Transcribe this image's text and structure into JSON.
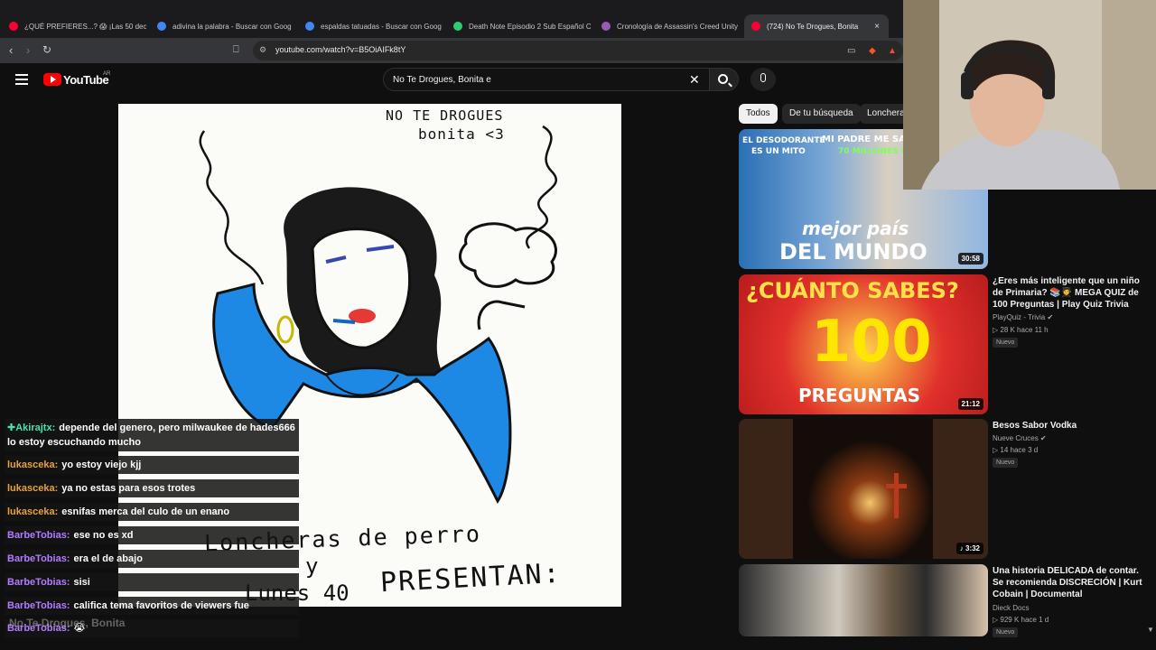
{
  "browser": {
    "tabs": [
      {
        "label": "¿QUÉ PREFIERES...? 😱 ¡Las 50 decisi",
        "color": "#ff0033"
      },
      {
        "label": "adivina la palabra - Buscar con Goog",
        "color": "#4285f4"
      },
      {
        "label": "espaldas tatuadas - Buscar con Goog",
        "color": "#4285f4"
      },
      {
        "label": "Death Note Episodio 2 Sub Español C",
        "color": "#2ecc71"
      },
      {
        "label": "Cronología de Assassin's Creed Unity",
        "color": "#9b59b6"
      },
      {
        "label": "(724) No Te Drogues, Bonita",
        "color": "#ff0033"
      }
    ],
    "tab_close": "×",
    "url": "youtube.com/watch?v=B5OiAIFk8tY"
  },
  "youtube": {
    "logo": "YouTube",
    "region": "AR",
    "search_value": "No Te Drogues, Bonita e",
    "clear": "✕"
  },
  "video": {
    "drawing_text": {
      "line1": "NO TE DROGUES",
      "line2": "bonita <3",
      "line3": "Loncheras de perro",
      "line4": "y",
      "line5": "Lunes 40",
      "line6": "PRESENTAN:"
    },
    "watermark": "No Te Drogues, Bonita"
  },
  "chat": [
    {
      "user": "✚Akirajtx:",
      "text": "depende del genero, pero milwaukee de hades666 lo estoy escuchando mucho",
      "color": "green"
    },
    {
      "user": "lukasceka:",
      "text": "yo estoy viejo kjj",
      "color": "orange"
    },
    {
      "user": "lukasceka:",
      "text": "ya no estas para esos trotes",
      "color": "orange"
    },
    {
      "user": "lukasceka:",
      "text": "esnifas merca del culo de un enano",
      "color": "orange"
    },
    {
      "user": "BarbeTobias:",
      "text": "ese no es xd",
      "color": "purple"
    },
    {
      "user": "BarbeTobias:",
      "text": "era el de abajo",
      "color": "purple"
    },
    {
      "user": "BarbeTobias:",
      "text": "sisi",
      "color": "purple"
    },
    {
      "user": "BarbeTobias:",
      "text": "califica tema favoritos de viewers fue",
      "color": "purple"
    },
    {
      "user": "BarbeTobias:",
      "text": "😭",
      "color": "purple"
    }
  ],
  "chips": [
    "Todos",
    "De tu búsqueda",
    "Loncheras"
  ],
  "recommendations": [
    {
      "title": "",
      "channel": "",
      "stats": "",
      "new_badge": "",
      "duration": "30:58",
      "thumb_text": [
        "EL DESODORANTE",
        "ES UN MITO",
        "MI PADRE ME SACÓ",
        "70 MILLONES USD",
        "mejor país",
        "DEL MUNDO"
      ]
    },
    {
      "title": "¿Eres más inteligente que un niño de Primaria? 📚🧑‍🎓 MEGA QUIZ de 100 Preguntas | Play Quiz Trivia",
      "channel": "PlayQuiz - Trivia ✔",
      "stats": "▷ 28 K   hace 11 h",
      "new_badge": "Nuevo",
      "duration": "21:12",
      "thumb_text": [
        "¿CUÁNTO SABES?",
        "100",
        "PREGUNTAS"
      ]
    },
    {
      "title": "Besos Sabor Vodka",
      "channel": "Nueve Cruces ✔",
      "stats": "▷ 14   hace 3 d",
      "new_badge": "Nuevo",
      "duration": "♪ 3:32",
      "thumb_text": []
    },
    {
      "title": "Una historia DELICADA de contar. Se recomienda DISCRECIÓN | Kurt Cobain | Documental",
      "channel": "Dieck Docs",
      "stats": "▷ 929 K   hace 1 d",
      "new_badge": "Nuevo",
      "duration": "",
      "thumb_text": []
    }
  ]
}
